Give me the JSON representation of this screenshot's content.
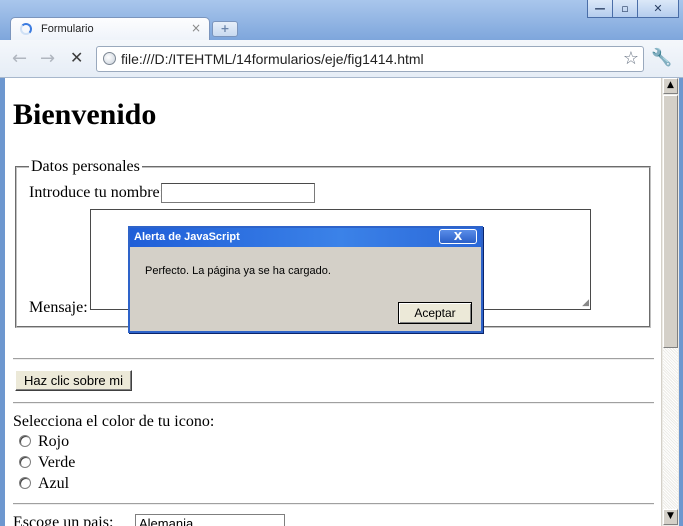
{
  "window": {
    "minimize": "—",
    "maximize": "▫",
    "close": "✕"
  },
  "tab": {
    "title": "Formulario",
    "close": "×",
    "new_tab": "+"
  },
  "toolbar": {
    "back": "←",
    "forward": "→",
    "stop": "✕",
    "url": "file:///D:/ITEHTML/14formularios/eje/fig1414.html",
    "bookmark_star": "☆",
    "wrench": "🔧"
  },
  "page": {
    "heading": "Bienvenido",
    "fieldset_legend": "Datos personales",
    "name_label": "Introduce tu nombre:",
    "name_value": "",
    "message_label": "Mensaje:",
    "message_value": "",
    "button_label": "Haz clic sobre mi",
    "color_question": "Selecciona el color de tu icono:",
    "radios": [
      "Rojo",
      "Verde",
      "Azul"
    ],
    "partial_label": "Escoge un pais:",
    "select_value": "Alemania"
  },
  "dialog": {
    "title": "Alerta de JavaScript",
    "close": "X",
    "message": "Perfecto. La página ya se ha cargado.",
    "ok_label": "Aceptar"
  },
  "scrollbar": {
    "up": "▲",
    "down": "▼"
  }
}
